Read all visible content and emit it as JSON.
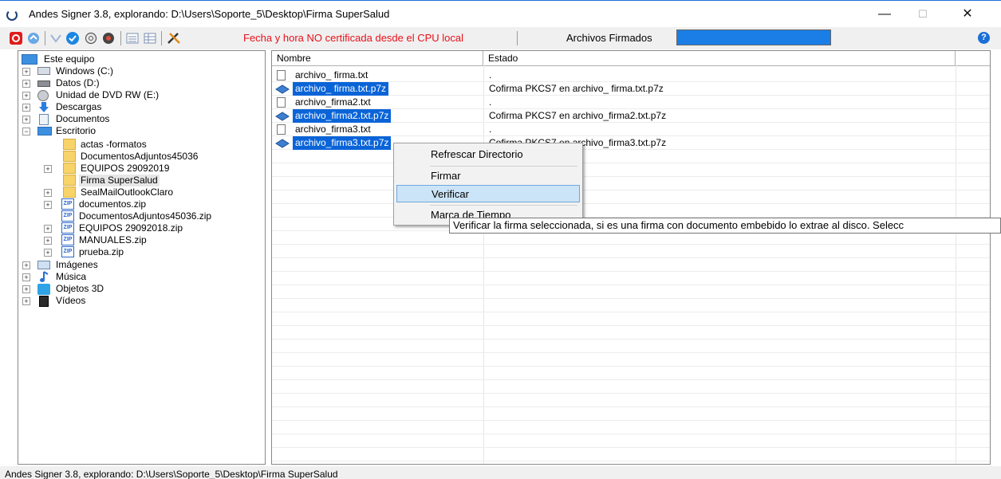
{
  "window": {
    "title": "Andes Signer 3.8, explorando: D:\\Users\\Soporte_5\\Desktop\\Firma SuperSalud",
    "minimize": "—",
    "maximize": "☐",
    "close": "✕"
  },
  "toolbar": {
    "icons": [
      "power-icon",
      "refresh-sign-icon",
      "sign-pen-icon",
      "verify-check-icon",
      "globe-icon",
      "disk-icon",
      "list-view-icon",
      "details-view-icon",
      "tools-icon"
    ],
    "warning_text": "Fecha y hora NO certificada desde el CPU local",
    "archivos_label": "Archivos Firmados",
    "help": "?"
  },
  "colors": {
    "selection": "#0a64d8",
    "warning": "#e8101a",
    "menu_highlight": "#cce4f7",
    "progress": "#1a7ee6"
  },
  "tree": {
    "root": "Este equipo",
    "drives": {
      "windows": "Windows (C:)",
      "datos": "Datos (D:)",
      "dvd": "Unidad de DVD RW (E:)",
      "descargas": "Descargas",
      "documentos": "Documentos",
      "escritorio": "Escritorio"
    },
    "escritorio_children": {
      "actas": "actas -formatos",
      "docadj": "DocumentosAdjuntos45036",
      "equipos": "EQUIPOS 29092019",
      "firma": "Firma SuperSalud",
      "seal": "SealMailOutlookClaro",
      "documentos_zip": "documentos.zip",
      "docadj_zip": "DocumentosAdjuntos45036.zip",
      "equipos_zip": "EQUIPOS 29092018.zip",
      "manuales_zip": "MANUALES.zip",
      "prueba_zip": "prueba.zip"
    },
    "others": {
      "imagenes": "Imágenes",
      "musica": "Música",
      "objetos": "Objetos 3D",
      "videos": "Vídeos"
    },
    "zip_tag": "ZIP"
  },
  "list": {
    "col_name": "Nombre",
    "col_status": "Estado",
    "rows": [
      {
        "name": "archivo_ firma.txt",
        "status": "."
      },
      {
        "name": "archivo_ firma.txt.p7z",
        "status": "Cofirma PKCS7 en archivo_ firma.txt.p7z"
      },
      {
        "name": "archivo_firma2.txt",
        "status": "."
      },
      {
        "name": "archivo_firma2.txt.p7z",
        "status": "Cofirma PKCS7 en archivo_firma2.txt.p7z"
      },
      {
        "name": "archivo_firma3.txt",
        "status": "."
      },
      {
        "name": "archivo_firma3.txt.p7z",
        "status": "Cofirma PKCS7 en archivo_firma3.txt.p7z"
      }
    ]
  },
  "context_menu": {
    "refrescar": "Refrescar Directorio",
    "firmar": "Firmar",
    "verificar": "Verificar",
    "marca": "Marca de Tiempo"
  },
  "tooltip": "Verificar la firma seleccionada, si es una firma con documento embebido lo extrae al disco. Selecc",
  "status": "Andes Signer 3.8, explorando: D:\\Users\\Soporte_5\\Desktop\\Firma SuperSalud"
}
